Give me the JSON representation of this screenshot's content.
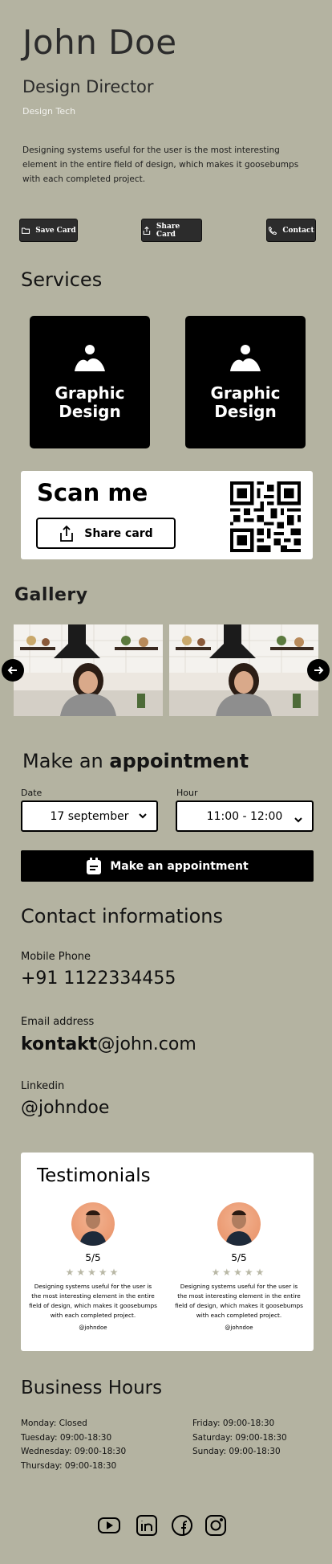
{
  "profile": {
    "name": "John Doe",
    "title": "Design Director",
    "company": "Design Tech",
    "bio": "Designing systems useful for the user is the most interesting element in the entire field of design, which makes it goosebumps with each completed project."
  },
  "actions": {
    "save_card": "Save Card",
    "share_card": "Share Card",
    "contact": "Contact"
  },
  "services": {
    "title": "Services",
    "items": [
      {
        "label": "Graphic Design",
        "icon": "image-icon"
      },
      {
        "label": "Graphic Design",
        "icon": "image-icon"
      }
    ]
  },
  "scan": {
    "title": "Scan me",
    "button": "Share card"
  },
  "gallery": {
    "title": "Gallery"
  },
  "appointment": {
    "title_prefix": "Make an",
    "title_bold": "appointment",
    "date_label": "Date",
    "date_value": "17 september",
    "hour_label": "Hour",
    "hour_value": "11:00 - 12:00",
    "button": "Make an appointment"
  },
  "contact": {
    "title": "Contact informations",
    "phone_label": "Mobile Phone",
    "phone": "+91 1122334455",
    "email_label": "Email address",
    "email_user": "kontakt",
    "email_domain": "@john.com",
    "linkedin_label": "Linkedin",
    "linkedin": "@johndoe"
  },
  "testimonials": {
    "title": "Testimonials",
    "items": [
      {
        "rating": "5/5",
        "stars": 5,
        "text": "Designing systems useful for the user is the most interesting element in the entire field of design, which makes it goosebumps with each completed project.",
        "handle": "@johndoe"
      },
      {
        "rating": "5/5",
        "stars": 5,
        "text": "Designing systems useful for the user is the most interesting element in the entire field of design, which makes it goosebumps with each completed project.",
        "handle": "@johndoe"
      }
    ]
  },
  "hours": {
    "title": "Business Hours",
    "left": [
      "Monday: Closed",
      "Tuesday: 09:00-18:30",
      "Wednesday: 09:00-18:30",
      "Thursday: 09:00-18:30"
    ],
    "right": [
      "Friday: 09:00-18:30",
      "Saturday: 09:00-18:30",
      "Sunday: 09:00-18:30"
    ]
  },
  "colors": {
    "background": "#b4b3a1",
    "dark": "#000000",
    "white": "#ffffff",
    "star": "#b9b8a6"
  },
  "social": [
    "youtube-icon",
    "linkedin-icon",
    "facebook-icon",
    "instagram-icon"
  ]
}
